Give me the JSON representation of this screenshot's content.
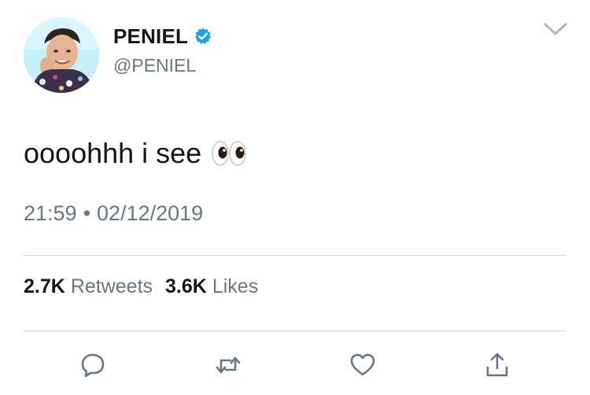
{
  "user": {
    "display_name": "PENIEL",
    "handle": "@PENIEL",
    "verified_icon": "verified-badge-icon",
    "verified_color": "#1da1f2"
  },
  "tweet": {
    "text": "oooohhh i see",
    "emoji_icon": "eyes-emoji-icon",
    "time": "21:59",
    "separator": "•",
    "date": "02/12/2019"
  },
  "stats": {
    "retweets_count": "2.7K",
    "retweets_label": "Retweets",
    "likes_count": "3.6K",
    "likes_label": "Likes"
  },
  "actions": [
    "reply-icon",
    "retweet-icon",
    "like-icon",
    "share-icon"
  ],
  "colors": {
    "text": "#14171a",
    "secondary": "#657786",
    "divider": "#cfd6dc",
    "action_icon": "#657786"
  }
}
